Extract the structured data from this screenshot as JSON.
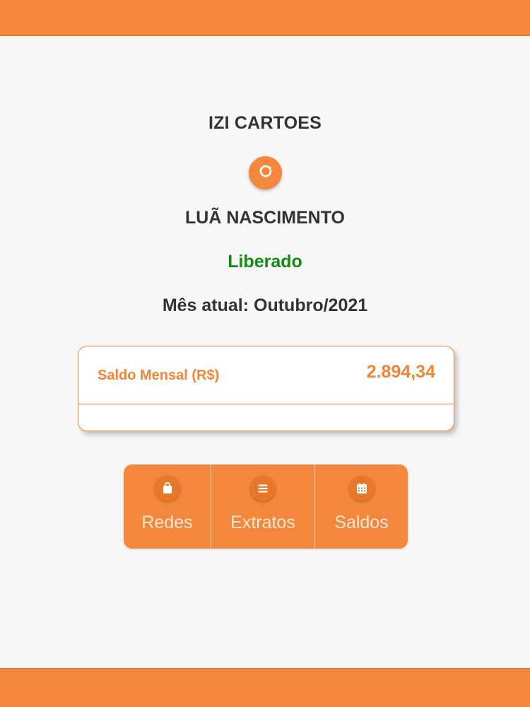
{
  "header": {
    "company_name": "IZI CARTOES",
    "refresh_icon": "refresh-icon"
  },
  "profile": {
    "user_name": "LUÃ NASCIMENTO",
    "status": "Liberado",
    "current_month": "Mês atual: Outubro/2021"
  },
  "balance_card": {
    "label": "Saldo Mensal (R$)",
    "value": "2.894,34"
  },
  "actions": [
    {
      "label": "Redes",
      "icon": "shopping-bag-icon"
    },
    {
      "label": "Extratos",
      "icon": "list-icon"
    },
    {
      "label": "Saldos",
      "icon": "calendar-icon"
    }
  ],
  "colors": {
    "accent": "#f3873b",
    "status_green": "#128a12",
    "text_dark": "#333333",
    "background": "#f7f7f7"
  }
}
